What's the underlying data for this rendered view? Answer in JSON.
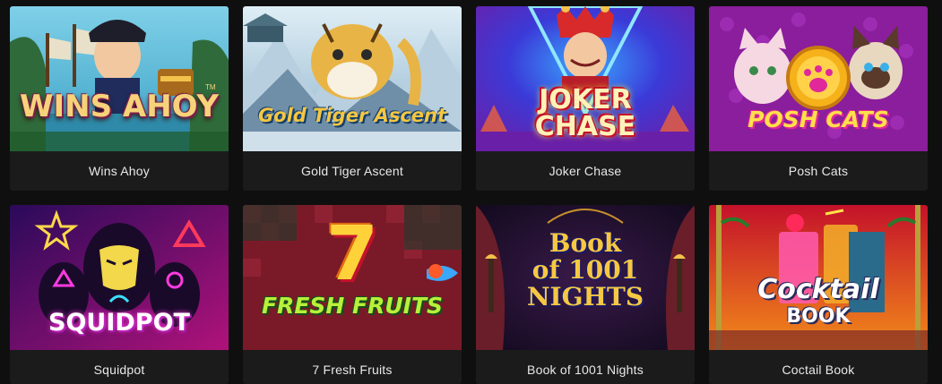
{
  "games": [
    {
      "title": "Wins Ahoy",
      "logo": "WINS AHOY",
      "logo_tm": "TM"
    },
    {
      "title": "Gold Tiger Ascent",
      "logo": "Gold Tiger Ascent"
    },
    {
      "title": "Joker Chase",
      "logo_line1": "JOKER",
      "logo_line2": "CHASE"
    },
    {
      "title": "Posh Cats",
      "logo": "POSH CATS"
    },
    {
      "title": "Squidpot",
      "logo": "SQUIDPOT"
    },
    {
      "title": "7 Fresh Fruits",
      "logo_num": "7",
      "logo": "FRESH FRUITS"
    },
    {
      "title": "Book of 1001 Nights",
      "logo_line1": "Book",
      "logo_line2": "of 1001",
      "logo_line3": "NIGHTS"
    },
    {
      "title": "Coctail Book",
      "logo_line1": "Cocktail",
      "logo_line2": "BOOK"
    }
  ],
  "colors": {
    "page_bg": "#0f0f0f",
    "card_bg": "#1b1b1b",
    "title_text": "#e8e8e8"
  }
}
